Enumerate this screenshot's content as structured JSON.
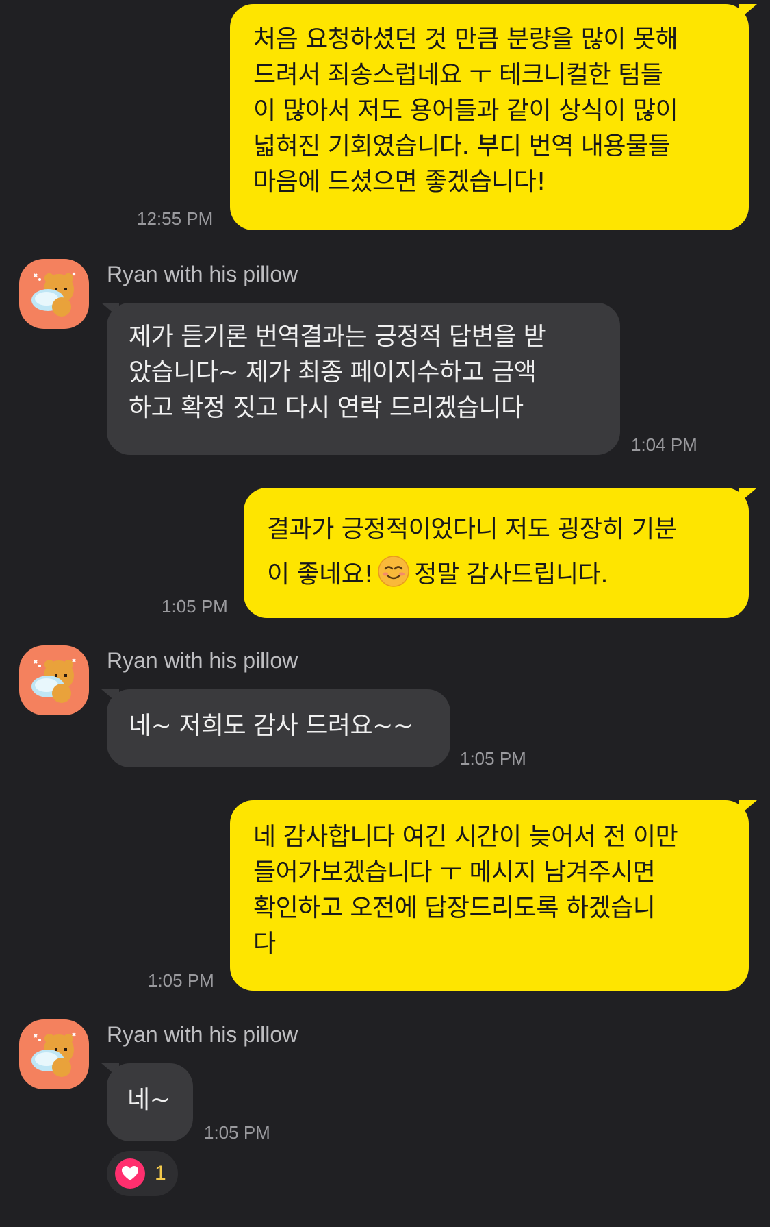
{
  "sender_name": "Ryan with his pillow",
  "messages": [
    {
      "from": "me",
      "lines": [
        "처음 요청하셨던 것 만큼 분량을 많이 못해",
        "드려서 죄송스럽네요 ㅜ 테크니컬한 텀들",
        "이 많아서 저도 용어들과 같이 상식이 많이",
        "넓혀진 기회였습니다. 부디 번역 내용물들",
        "마음에 드셨으면 좋겠습니다!"
      ],
      "time": "12:55 PM"
    },
    {
      "from": "them",
      "lines": [
        "제가 듣기론 번역결과는 긍정적 답변을 받",
        "았습니다~ 제가 최종 페이지수하고 금액",
        "하고 확정 짓고 다시 연락 드리겠습니다"
      ],
      "time": "1:04 PM"
    },
    {
      "from": "me",
      "lines": [
        "결과가 긍정적이었다니 저도 굉장히 기분",
        "이 좋네요!",
        "정말 감사드립니다."
      ],
      "emoji": "smiling-face-icon",
      "time": "1:05 PM"
    },
    {
      "from": "them",
      "lines": [
        "네~ 저희도 감사 드려요~~"
      ],
      "time": "1:05 PM"
    },
    {
      "from": "me",
      "lines": [
        "네 감사합니다 여긴 시간이 늦어서 전 이만",
        "들어가보겠습니다 ㅜ 메시지 남겨주시면",
        "확인하고 오전에 답장드리도록 하겠습니",
        "다"
      ],
      "time": "1:05 PM"
    },
    {
      "from": "them",
      "lines": [
        "네~"
      ],
      "time": "1:05 PM"
    }
  ],
  "reaction": {
    "icon": "heart-icon",
    "count": "1",
    "color": "#FF2F6E"
  },
  "colors": {
    "background": "#202023",
    "my_bubble": "#FEE500",
    "their_bubble": "#3A3A3D",
    "avatar": "#F4815E"
  }
}
